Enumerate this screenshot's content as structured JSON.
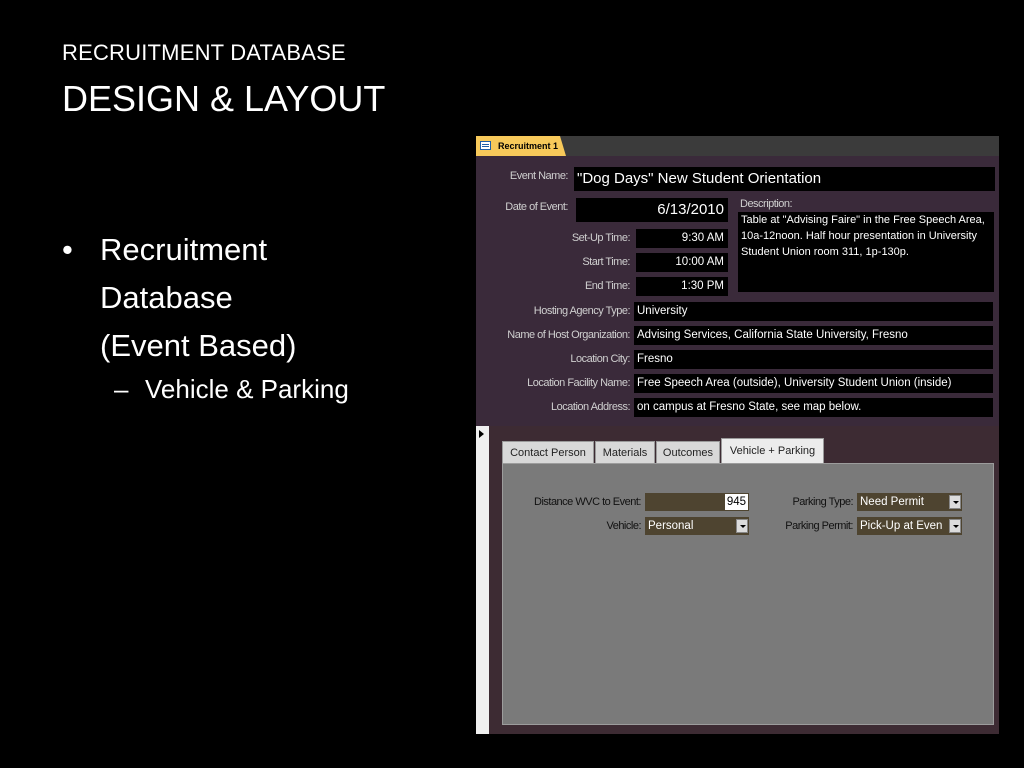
{
  "slide": {
    "title_line1": "RECRUITMENT DATABASE",
    "title_line2": "DESIGN & LAYOUT",
    "bullet_symbol": "•",
    "bullet_line1": "Recruitment",
    "bullet_line2": "Database",
    "bullet_line3": "(Event Based)",
    "sub_symbol": "–",
    "sub_bullet": "Vehicle & Parking"
  },
  "form": {
    "tab_title": "Recruitment 1",
    "fields": {
      "event_name": {
        "label": "Event Name:",
        "value": "\"Dog Days\" New Student Orientation"
      },
      "date_of_event": {
        "label": "Date of Event:",
        "value": "6/13/2010"
      },
      "setup_time": {
        "label": "Set-Up Time:",
        "value": "9:30 AM"
      },
      "start_time": {
        "label": "Start Time:",
        "value": "10:00 AM"
      },
      "end_time": {
        "label": "End Time:",
        "value": "1:30 PM"
      },
      "description": {
        "label": "Description:",
        "value": "Table at \"Advising Faire\" in the Free Speech Area, 10a-12noon.  Half hour presentation in University Student Union room 311, 1p-130p."
      },
      "hosting_agency_type": {
        "label": "Hosting Agency Type:",
        "value": "University"
      },
      "host_org_name": {
        "label": "Name of Host Organization:",
        "value": "Advising Services, California State University, Fresno"
      },
      "location_city": {
        "label": "Location City:",
        "value": "Fresno"
      },
      "location_facility": {
        "label": "Location Facility Name:",
        "value": "Free Speech Area (outside), University Student Union (inside)"
      },
      "location_address": {
        "label": "Location Address:",
        "value": "on campus at Fresno State, see map below."
      }
    },
    "subtabs": [
      "Contact Person",
      "Materials",
      "Outcomes",
      "Vehicle + Parking"
    ],
    "active_subtab": "Vehicle + Parking",
    "vehicle": {
      "distance_label": "Distance WVC to Event:",
      "distance_value": "945",
      "vehicle_label": "Vehicle:",
      "vehicle_value": "Personal",
      "parking_type_label": "Parking Type:",
      "parking_type_value": "Need Permit",
      "parking_permit_label": "Parking Permit:",
      "parking_permit_value": "Pick-Up at Even"
    }
  },
  "colors": {
    "background": "#000000",
    "form_bg": "#3a2a3a",
    "field_bg": "#000000",
    "tab_accent": "#f7c95a",
    "page_bg": "#7a7a7a",
    "combo_bg": "#4e4430"
  },
  "icons": {
    "form_tab_icon": "form-icon",
    "record_selector": "record-selector-arrow-icon",
    "dropdown": "dropdown-arrow-icon"
  }
}
